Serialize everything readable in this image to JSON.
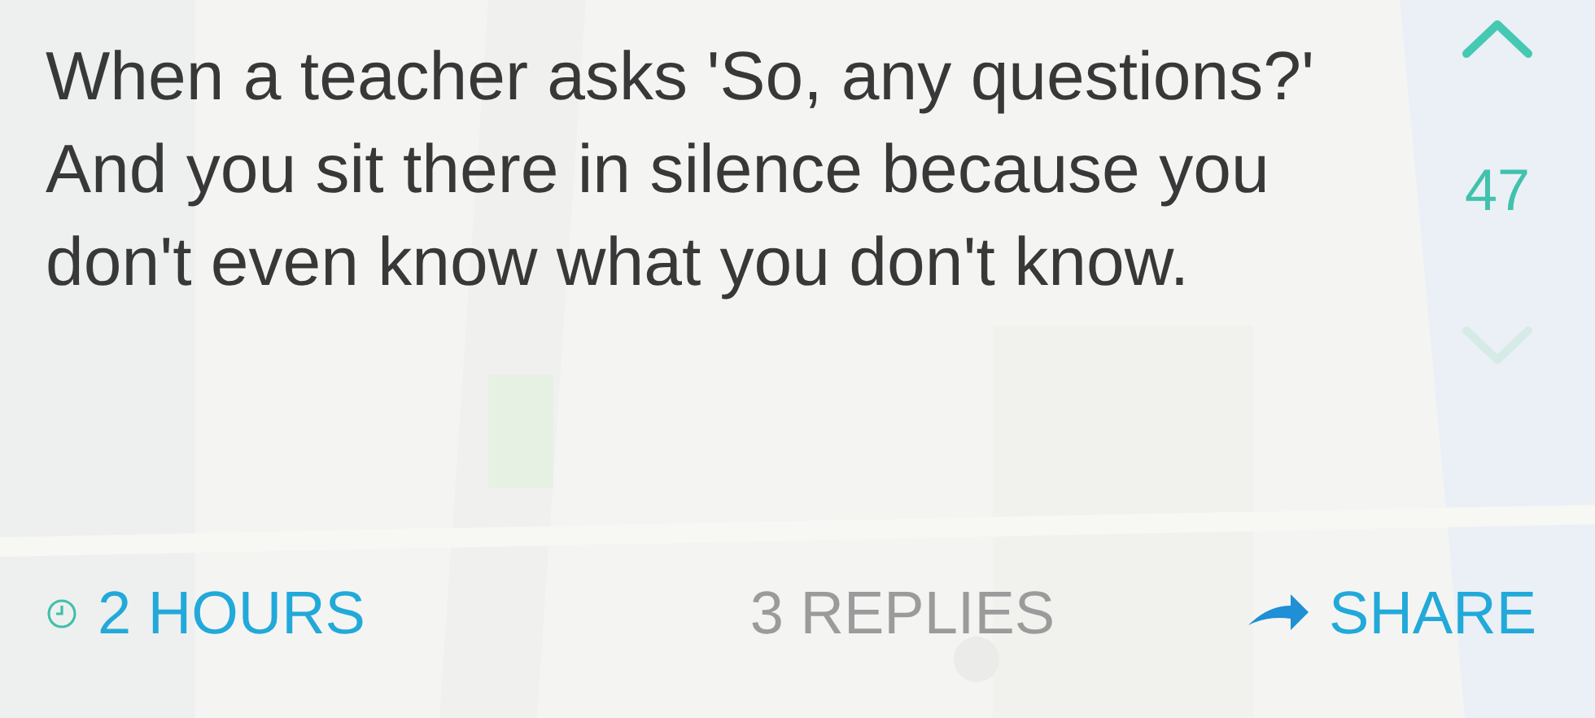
{
  "post": {
    "text": "When a teacher asks 'So, any questions?' And you sit there in silence because you don't even know what you don't know."
  },
  "vote": {
    "upvoted": true,
    "downvoted": false,
    "count": "47"
  },
  "footer": {
    "time": "2 HOURS",
    "replies": "3 REPLIES",
    "share": "SHARE"
  }
}
